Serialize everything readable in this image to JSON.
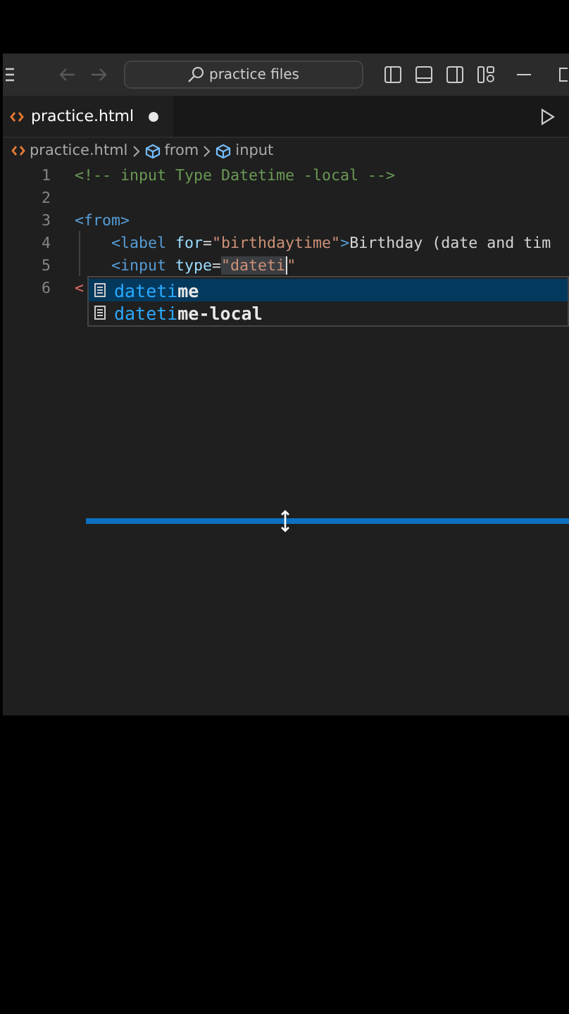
{
  "title_bar": {
    "nav": [
      {
        "kind": "back",
        "disabled": true
      },
      {
        "kind": "forward",
        "disabled": true
      }
    ],
    "search": {
      "value": "practice files"
    }
  },
  "tabs": [
    {
      "label": "practice.html",
      "selected": true,
      "modified": true
    }
  ],
  "breadcrumb": [
    {
      "kind": "file",
      "label": "practice.html"
    },
    {
      "kind": "symbol",
      "label": "from"
    },
    {
      "kind": "symbol",
      "label": "input"
    }
  ],
  "lines": [
    {
      "number": "1",
      "tokens": [
        {
          "kind": "comment",
          "text": "<!-- input Type Datetime -local -->"
        }
      ]
    },
    {
      "number": "2"
    },
    {
      "number": "3",
      "tokens": [
        {
          "kind": "tag",
          "text": "<from>"
        }
      ]
    },
    {
      "number": "4",
      "indented": true,
      "tokens": [
        {
          "kind": "tag",
          "text": "<label "
        },
        {
          "kind": "attr",
          "text": "for"
        },
        {
          "kind": "text",
          "text": "="
        },
        {
          "kind": "string",
          "text": "\"birthdaytime\""
        },
        {
          "kind": "tag",
          "text": ">"
        },
        {
          "kind": "text",
          "text": "Birthday (date and tim"
        }
      ]
    },
    {
      "number": "5",
      "indented": true,
      "tokens": [
        {
          "kind": "tag",
          "text": "<input "
        },
        {
          "kind": "attr",
          "text": "type"
        },
        {
          "kind": "text",
          "text": "="
        },
        {
          "kind": "string",
          "text": "\"dateti",
          "caret": true
        },
        {
          "kind": "string",
          "text": "\""
        }
      ]
    },
    {
      "number": "6",
      "tokens": [
        {
          "kind": "bracket",
          "text": "<"
        }
      ]
    }
  ],
  "suggestions": [
    {
      "label": "dateti**me**",
      "selected": true
    },
    {
      "label": "dateti**me-local**",
      "selected": false
    }
  ]
}
